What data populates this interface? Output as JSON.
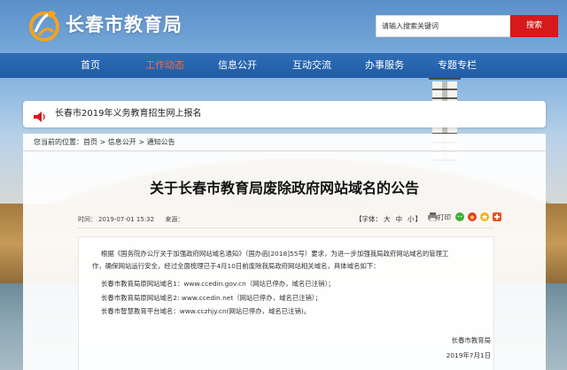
{
  "header": {
    "site_title": "长春市教育局",
    "search_placeholder": "请输入搜索关键词",
    "search_button": "搜索"
  },
  "nav": {
    "items": [
      {
        "label": "首页"
      },
      {
        "label": "工作动态"
      },
      {
        "label": "信息公开"
      },
      {
        "label": "互动交流"
      },
      {
        "label": "办事服务"
      },
      {
        "label": "专题专栏"
      }
    ],
    "active_index": 1
  },
  "notice": {
    "text": "长春市2019年义务教育招生网上报名"
  },
  "breadcrumb": {
    "prefix": "您当前的位置：",
    "items": [
      "首页",
      "信息公开",
      "通知公告"
    ],
    "separator": " > "
  },
  "article": {
    "title": "关于长春市教育局废除政府网站域名的公告",
    "time_label": "时间：",
    "time": "2019-07-01 15:32",
    "source_label": "来源：",
    "font_label": "【字体：",
    "font_sizes": [
      "大",
      "中",
      "小"
    ],
    "font_close": "】",
    "print_label": "打印",
    "paragraph_1": "根据《国务院办公厅关于加强政府网站域名通知》（国办函[2018]55号）要求，为进一步加强我局政府网站域名的管理工",
    "paragraph_1b": "作，确保网站运行安全，经过全面梳理已于4月10日前废除我局政府网站相关域名，具体域名如下：",
    "line_1": "长春市教育局原网站域名1：www.ccedin.gov.cn（网站已停办，域名已注销）；",
    "line_2": "长春市教育局原网站域名2: www.ccedin.net（网站已停办，域名已注销）；",
    "line_3": "长春市智慧教育平台域名：www.cczhjy.cn(网站已停办，域名已注销)。",
    "signature": "长春市教育局",
    "date": "2019年7月1日"
  },
  "colors": {
    "nav_bg": "#215ca5",
    "nav_active": "#ff6a3d",
    "search_button": "#d6191b",
    "notice_icon": "#d6191b"
  }
}
